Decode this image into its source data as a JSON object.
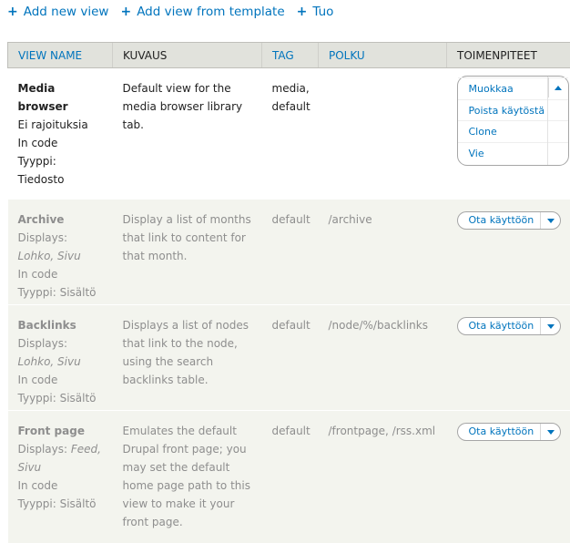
{
  "actions": {
    "add_new_view": "Add new view",
    "add_from_template": "Add view from template",
    "import": "Tuo"
  },
  "columns": {
    "view_name": "VIEW NAME",
    "description": "KUVAUS",
    "tag": "TAG",
    "path": "POLKU",
    "operations": "TOIMENPITEET"
  },
  "rows": [
    {
      "name": "Media browser",
      "lines": [
        "Ei rajoituksia",
        "In code",
        "Tyyppi:",
        "Tiedosto"
      ],
      "description": "Default view for the media browser library tab.",
      "tag": "media, default",
      "path": "",
      "operations_open": true,
      "operations": [
        "Muokkaa",
        "Poista käytöstä",
        "Clone",
        "Vie"
      ]
    },
    {
      "name": "Archive",
      "displays_label": "Displays:",
      "displays": "Lohko, Sivu",
      "storage": "In code",
      "type": "Tyyppi: Sisältö",
      "description": "Display a list of months that link to content for that month.",
      "tag": "default",
      "path": "/archive",
      "operation": "Ota käyttöön"
    },
    {
      "name": "Backlinks",
      "displays_label": "Displays:",
      "displays": "Lohko, Sivu",
      "storage": "In code",
      "type": "Tyyppi: Sisältö",
      "description": "Displays a list of nodes that link to the node, using the search backlinks table.",
      "tag": "default",
      "path": "/node/%/backlinks",
      "operation": "Ota käyttöön"
    },
    {
      "name": "Front page",
      "displays_label": "Displays:",
      "displays": "Feed, Sivu",
      "storage": "In code",
      "type": "Tyyppi: Sisältö",
      "description": "Emulates the default Drupal front page; you may set the default home page path to this view to make it your front page.",
      "tag": "default",
      "path": "/frontpage, /rss.xml",
      "operation": "Ota käyttöön"
    }
  ],
  "colors": {
    "link": "#0074bd",
    "header_bg": "#e1e2dc",
    "disabled_row_bg": "#f3f4ee",
    "disabled_text": "#8e8e8e"
  },
  "icons": {
    "add": "plus-icon",
    "dropdown": "chevron-down-icon",
    "dropdown_open": "chevron-up-icon"
  }
}
